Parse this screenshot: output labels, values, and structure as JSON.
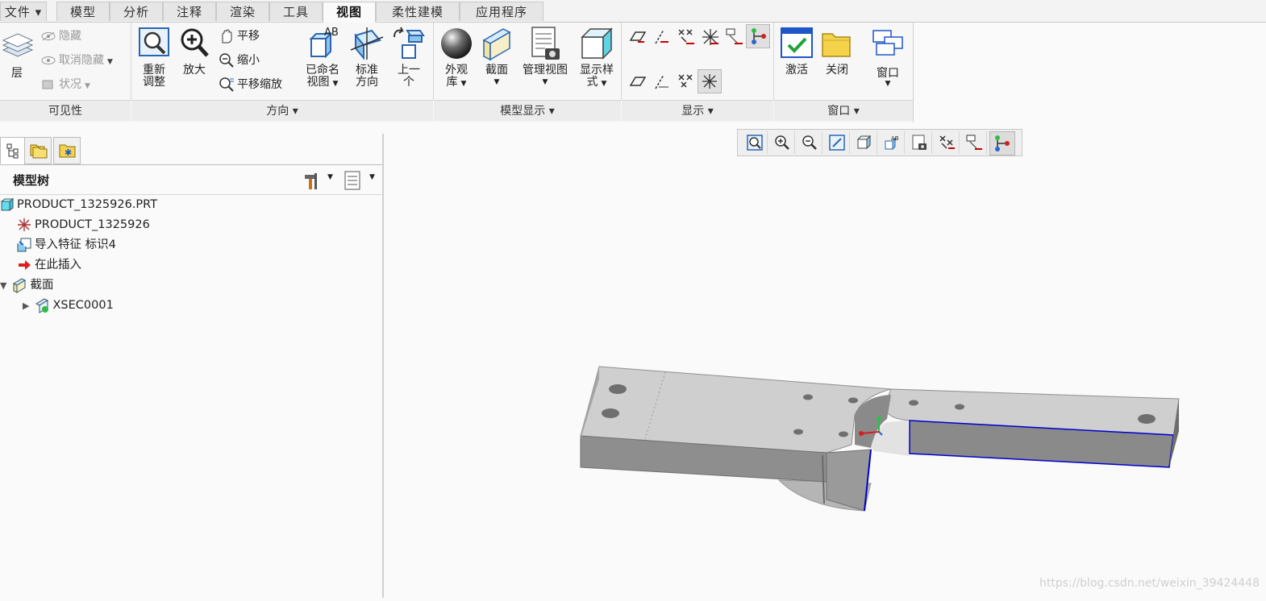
{
  "tabs": [
    {
      "label": "文件 ▾",
      "active": false
    },
    {
      "label": "模型",
      "active": false
    },
    {
      "label": "分析",
      "active": false
    },
    {
      "label": "注释",
      "active": false
    },
    {
      "label": "渲染",
      "active": false
    },
    {
      "label": "工具",
      "active": false
    },
    {
      "label": "视图",
      "active": true
    },
    {
      "label": "柔性建模",
      "active": false
    },
    {
      "label": "应用程序",
      "active": false
    }
  ],
  "ribbon": {
    "visibility": {
      "layer": "层",
      "hide": "隐藏",
      "unhide": "取消隐藏",
      "status": "状况",
      "group": "可见性"
    },
    "orientation": {
      "refit": [
        "重新",
        "调整"
      ],
      "zoom_in": "放大",
      "pan": "平移",
      "zoom_out": "缩小",
      "pan_zoom": "平移缩放",
      "named_views": [
        "已命名",
        "视图"
      ],
      "standard": [
        "标准",
        "方向"
      ],
      "previous": [
        "上一",
        "个"
      ],
      "group": "方向 ▾"
    },
    "model_display": {
      "appearance": [
        "外观",
        "库"
      ],
      "section": "截面",
      "manage_views": "管理视图",
      "display_style": [
        "显示样",
        "式"
      ],
      "group": "模型显示 ▾"
    },
    "show": {
      "group": "显示 ▾"
    },
    "window": {
      "activate": "激活",
      "close": "关闭",
      "window": "窗口",
      "group": "窗口 ▾"
    }
  },
  "tree": {
    "title": "模型树",
    "nodes": [
      {
        "label": "PRODUCT_1325926.PRT",
        "icon": "part-icon"
      },
      {
        "label": "PRODUCT_1325926",
        "icon": "csys-icon"
      },
      {
        "label": "导入特征 标识4",
        "icon": "import-feature-icon"
      },
      {
        "label": "在此插入",
        "icon": "insert-arrow-icon"
      },
      {
        "label": "截面",
        "icon": "section-icon"
      },
      {
        "label": "XSEC0001",
        "icon": "xsec-icon"
      }
    ]
  },
  "watermark": "https://blog.csdn.net/weixin_39424448",
  "colors": {
    "accent_blue": "#1e56c8",
    "section_edge": "#0000cc",
    "model_top": "#c9c9c9",
    "model_side": "#8a8a8a"
  }
}
